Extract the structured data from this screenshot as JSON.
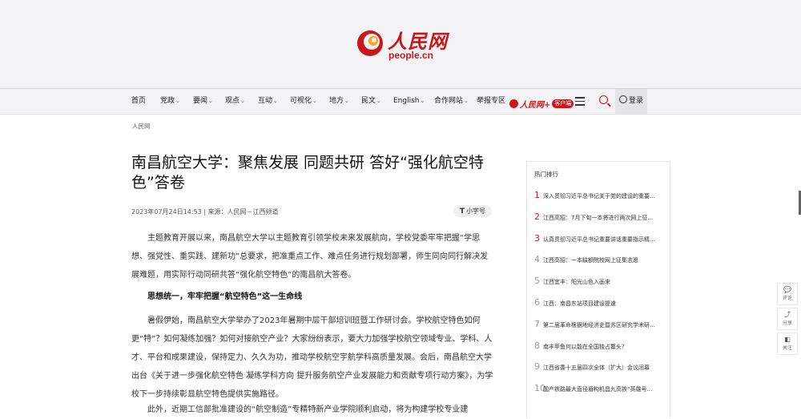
{
  "header": {
    "logo_text": "人民网",
    "logo_sub": "people.cn"
  },
  "nav": {
    "items": [
      {
        "label": "首页",
        "caret": false
      },
      {
        "label": "党政",
        "caret": true
      },
      {
        "label": "要闻",
        "caret": true
      },
      {
        "label": "观点",
        "caret": true
      },
      {
        "label": "互动",
        "caret": true
      },
      {
        "label": "可视化",
        "caret": true
      },
      {
        "label": "地方",
        "caret": true
      },
      {
        "label": "民文",
        "caret": true
      },
      {
        "label": "English",
        "caret": true
      },
      {
        "label": "合作网站",
        "caret": true
      },
      {
        "label": "举报专区",
        "caret": false
      }
    ],
    "app_label": "人民网+",
    "app_badge": "客户端",
    "login_label": "登录"
  },
  "breadcrumb": "人民网",
  "article": {
    "title": "南昌航空大学：聚焦发展 同题共研 答好“强化航空特色”答卷",
    "meta": "2023年07月24日14:53 | 来源：人民网－江西频道",
    "font_button": "小字号",
    "paragraph1": "主题教育开展以来，南昌航空大学以主题教育引领学校未来发展航向，学校党委牢牢把握“学思想、强党性、重实践、建新功”总要求，把准重点工作、难点任务进行规划部署，师生同向同行解决发展难题，用实际行动同研共答“强化航空特色”的南昌航大答卷。",
    "subhead": "思想统一，牢牢把握“航空特色”这一生命线",
    "paragraph2": "暑假伊始，南昌航空大学举办了2023年暑期中层干部培训班暨工作研讨会。学校航空特色如何更“特”？如何凝练加强？如何对接航空产业？大家纷纷表示，要大力加强学校航空领域专业、学科、人才、平台和成果建设，保持定力、久久为功，推动学校航空宇航学科高质量发展。会后，南昌航空大学出台《关于进一步强化航空特色 凝练学科方向 提升服务航空产业发展能力和贡献专项行动方案》，为学校下一步持续彰显航空特色提供实施路径。",
    "paragraph3": "此外，近期工信部批准建设的“航空制造”专精特新产业学院顺利启动，将为构建学校专业建"
  },
  "hot": {
    "title": "热门排行",
    "items": [
      {
        "num": "1",
        "text": "深入贯彻习近平总书记关于党的建设的重要..."
      },
      {
        "num": "2",
        "text": "江西高招：7月下旬一本将进行两次网上征..."
      },
      {
        "num": "3",
        "text": "认真贯彻习近平总书记重要讲话重要指示精..."
      },
      {
        "num": "4",
        "text": "江西高招：一本缺额院校网上征集志愿"
      },
      {
        "num": "5",
        "text": "江西宜丰：阳光山色入画来"
      },
      {
        "num": "6",
        "text": "江西：南昌东站项目建设提速"
      },
      {
        "num": "7",
        "text": "第二届革命根据地经济史暨苏区研究学术研..."
      },
      {
        "num": "8",
        "text": "南丰甲鱼何以能在全国独占鳌头？"
      },
      {
        "num": "9",
        "text": "江西省委十五届四次全体（扩大）会议闭幕"
      },
      {
        "num": "10",
        "text": "国产铁路最大直径盾构机昌九高铁“英雄号..."
      }
    ]
  },
  "side_tools": [
    {
      "icon": "comment-icon",
      "label": "评论"
    },
    {
      "icon": "share-icon",
      "label": "分享"
    },
    {
      "icon": "follow-icon",
      "label": "关注"
    }
  ],
  "side_icon_glyphs": [
    "💬",
    "⤴",
    "◧"
  ],
  "colors": {
    "brand": "#c9171e"
  }
}
